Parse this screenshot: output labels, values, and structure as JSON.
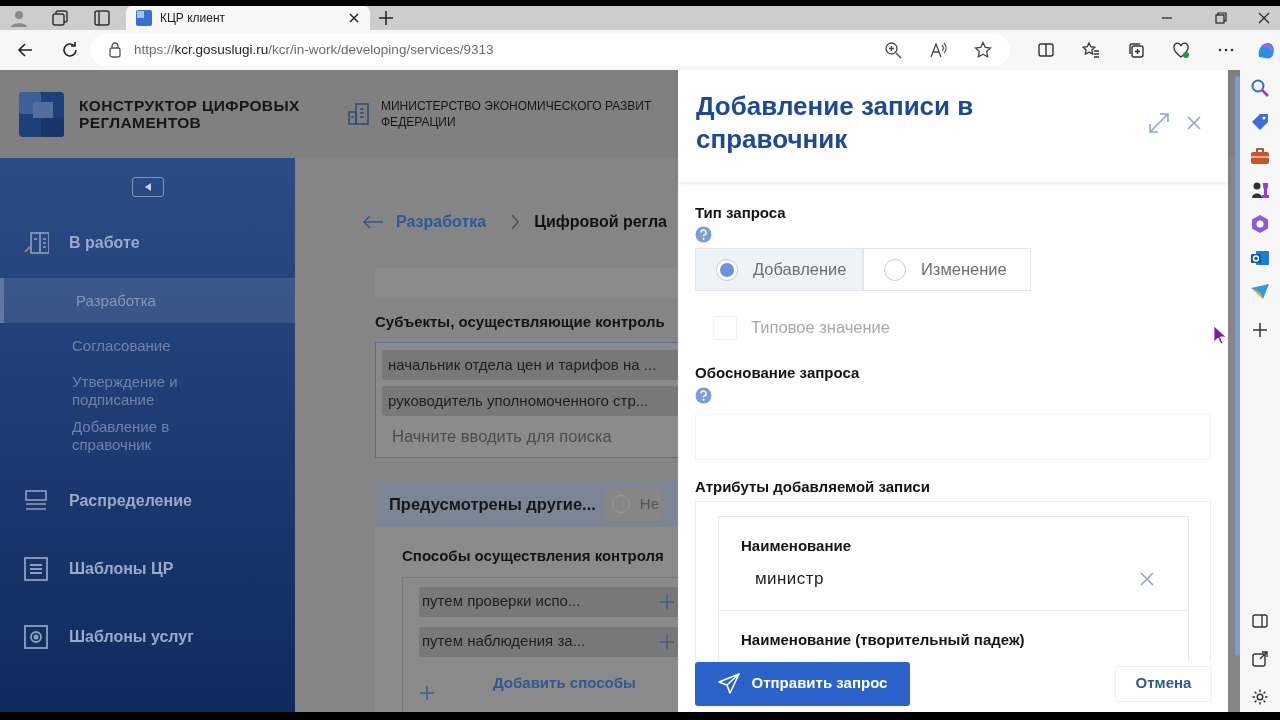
{
  "browser": {
    "tab_title": "КЦР клиент",
    "url_scheme": "https://",
    "url_host": "kcr.gosuslugi.ru",
    "url_path": "/kcr/in-work/developing/services/9313"
  },
  "header": {
    "logo_title": "КОНСТРУКТОР ЦИФРОВЫХ РЕГЛАМЕНТОВ",
    "org_lines": [
      "МИНИСТЕРСТВО ЭКОНОМИЧЕСКОГО РАЗВИТ",
      "ФЕДЕРАЦИИ"
    ]
  },
  "sidebar": {
    "items": [
      {
        "label": "В работе",
        "kind": "inwork",
        "expanded": true,
        "children": [
          {
            "label": "Разработка",
            "selected": true
          },
          {
            "label": "Согласование",
            "selected": false
          },
          {
            "label": "Утверждение и подписание",
            "selected": false
          },
          {
            "label": "Добавление в справочник",
            "selected": false
          }
        ]
      },
      {
        "label": "Распределение",
        "kind": "distribution",
        "expanded": false
      },
      {
        "label": "Шаблоны ЦР",
        "kind": "templates",
        "expanded": false
      },
      {
        "label": "Шаблоны услуг",
        "kind": "services",
        "expanded": false
      }
    ]
  },
  "main": {
    "breadcrumb": {
      "back": "Разработка",
      "current": "Цифровой регла"
    },
    "subjects_label": "Субъекты, осуществляющие контроль",
    "subjects": [
      "начальник отдела цен и тарифов на ...",
      "руководитель уполномоченного стр..."
    ],
    "search_placeholder": "Начните вводить для поиска",
    "panel_title": "Предусмотрены другие...",
    "panel_radio": {
      "label": "Не",
      "selected": false
    },
    "methods_label": "Способы осуществления контроля",
    "methods": [
      "путем проверки испо...",
      "путем наблюдения за..."
    ],
    "add_methods": "Добавить способы"
  },
  "drawer": {
    "title": "Добавление записи в справочник",
    "request_type_label": "Тип запроса",
    "request_types": [
      {
        "label": "Добавление",
        "selected": true
      },
      {
        "label": "Изменение",
        "selected": false
      }
    ],
    "typical": {
      "label": "Типовое значение",
      "checked": false,
      "disabled": true
    },
    "reason_label": "Обоснование запроса",
    "attributes_label": "Атрибуты добавляемой записи",
    "attributes": [
      {
        "label": "Наименование",
        "value": "министр"
      },
      {
        "label": "Наименование (творительный падеж)"
      }
    ],
    "submit": "Отправить запрос",
    "cancel": "Отмена"
  }
}
